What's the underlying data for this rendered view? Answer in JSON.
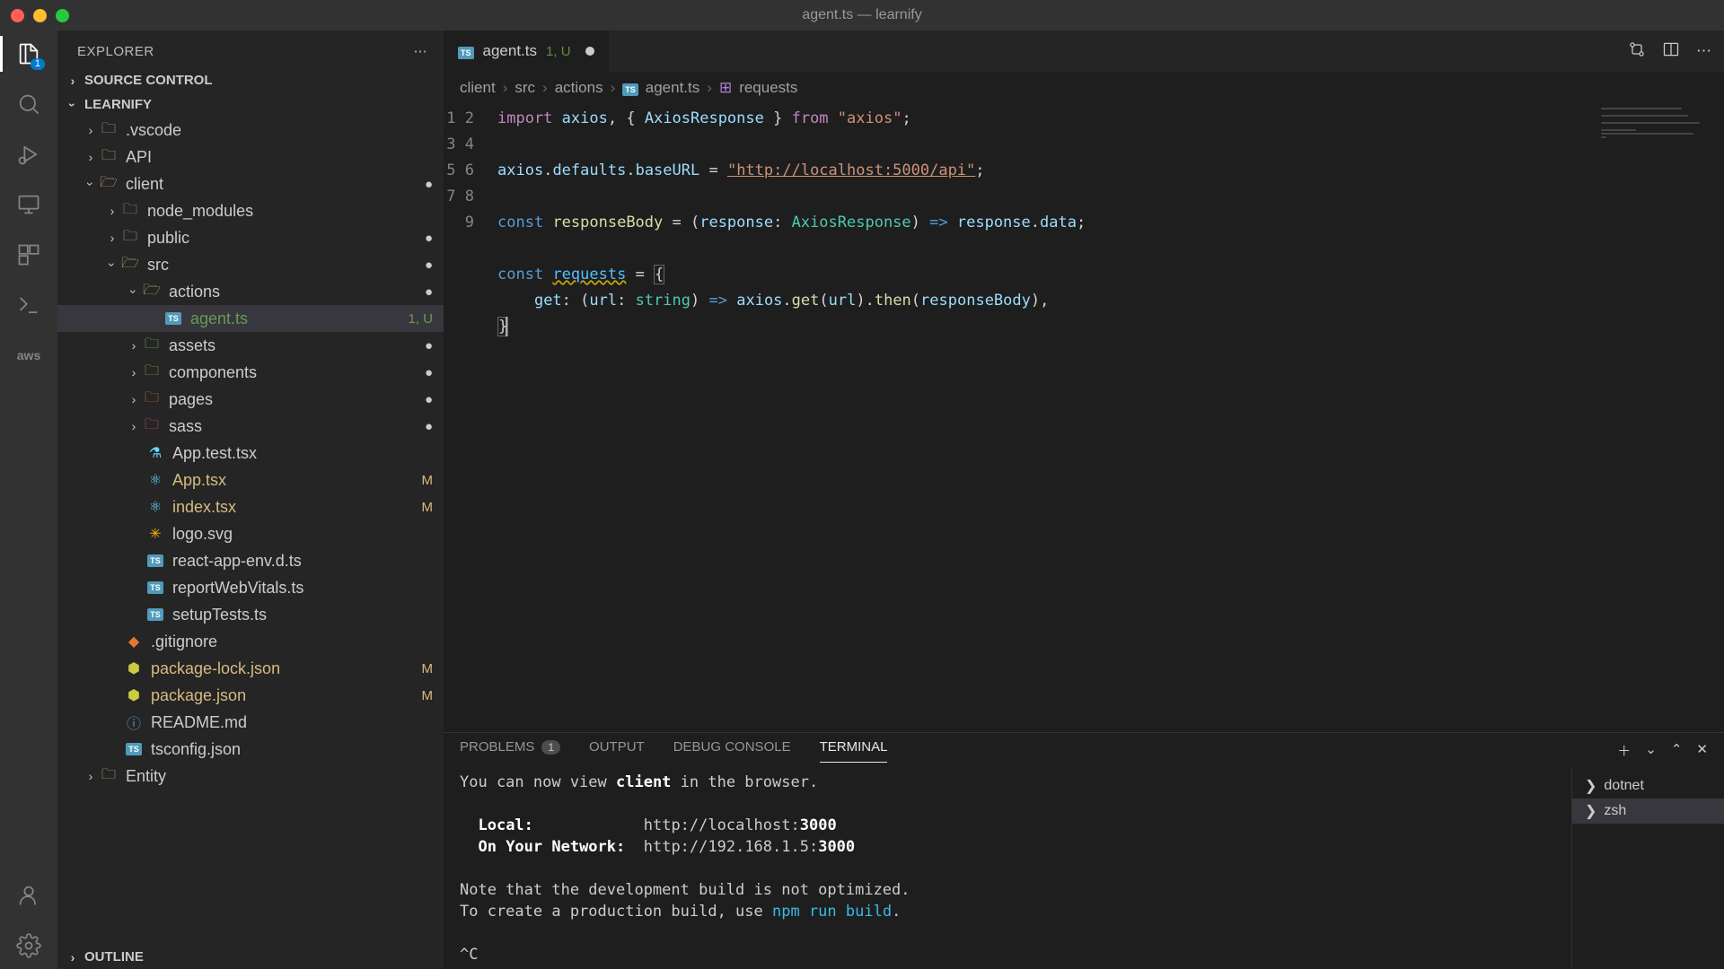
{
  "window": {
    "title": "agent.ts — learnify"
  },
  "explorer": {
    "title": "EXPLORER",
    "sections": {
      "sourceControl": "SOURCE CONTROL",
      "learnify": "LEARNIFY",
      "outline": "OUTLINE"
    },
    "tree": {
      "vscode": ".vscode",
      "api": "API",
      "client": "client",
      "node_modules": "node_modules",
      "public": "public",
      "src": "src",
      "actions": "actions",
      "agent": "agent.ts",
      "agent_status": "1, U",
      "assets": "assets",
      "components": "components",
      "pages": "pages",
      "sass": "sass",
      "app_test": "App.test.tsx",
      "app": "App.tsx",
      "index": "index.tsx",
      "logo": "logo.svg",
      "rae": "react-app-env.d.ts",
      "rwv": "reportWebVitals.ts",
      "st": "setupTests.ts",
      "gitignore": ".gitignore",
      "pkglock": "package-lock.json",
      "pkg": "package.json",
      "readme": "README.md",
      "tsconfig": "tsconfig.json",
      "entity": "Entity"
    }
  },
  "tab": {
    "filename": "agent.ts",
    "status": "1, U"
  },
  "tabbar_actions": {
    "compare": true,
    "split": true,
    "more": true
  },
  "breadcrumb": {
    "parts": [
      "client",
      "src",
      "actions",
      "agent.ts",
      "requests"
    ]
  },
  "code": {
    "lines": [
      1,
      2,
      3,
      4,
      5,
      6,
      7,
      8,
      9
    ],
    "l1_import": "import",
    "l1_axios": "axios",
    "l1_AxiosResponse": "AxiosResponse",
    "l1_from": "from",
    "l1_pkg": "\"axios\"",
    "l3_prefix": "axios",
    "l3_defaults": "defaults",
    "l3_baseURL": "baseURL",
    "l3_url": "\"http://localhost:5000/api\"",
    "l5_const": "const",
    "l5_rb": "responseBody",
    "l5_resp": "response",
    "l5_type": "AxiosResponse",
    "l5_data": "data",
    "l7_req": "requests",
    "l8_get": "get",
    "l8_url": "url",
    "l8_string": "string",
    "l8_axiosget": "get",
    "l8_then": "then"
  },
  "panel": {
    "tabs": {
      "problems": "PROBLEMS",
      "problems_count": "1",
      "output": "OUTPUT",
      "debug": "DEBUG CONSOLE",
      "terminal": "TERMINAL"
    }
  },
  "terminal": {
    "line1_pre": "You can now view ",
    "line1_client": "client",
    "line1_post": " in the browser.",
    "local_label": "Local:",
    "local_url": "http://localhost:",
    "local_port": "3000",
    "net_label": "On Your Network:",
    "net_url": "http://192.168.1.5:",
    "net_port": "3000",
    "note1": "Note that the development build is not optimized.",
    "note2_pre": "To create a production build, use ",
    "note2_cmd": "npm run build",
    "note2_post": ".",
    "ctrlc": "^C",
    "shells": {
      "dotnet": "dotnet",
      "zsh": "zsh"
    }
  },
  "activity": {
    "explorer_badge": "1"
  }
}
